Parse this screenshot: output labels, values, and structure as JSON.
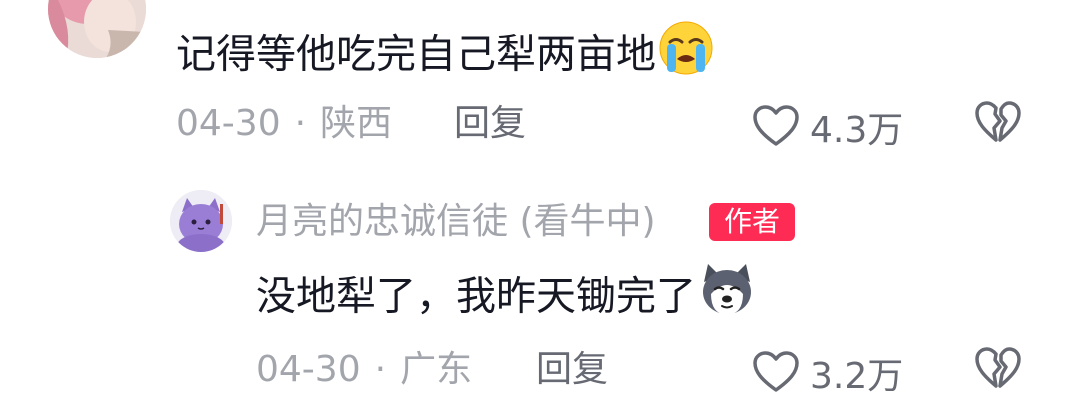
{
  "top_comment": {
    "text": "记得等他吃完自己犁两亩地",
    "emoji": "loudly-crying-face",
    "date": "04-30",
    "separator": "·",
    "location": "陕西",
    "reply_label": "回复",
    "likes": "4.3万"
  },
  "reply_comment": {
    "username": "月亮的忠诚信徒 (看牛中)",
    "badge": "作者",
    "text": "没地犁了，我昨天锄完了",
    "emoji": "husky-dog-face",
    "date": "04-30",
    "separator": "·",
    "location": "广东",
    "reply_label": "回复",
    "likes": "3.2万"
  },
  "colors": {
    "primary_text": "#161823",
    "secondary_text": "#a3a5ac",
    "action_text": "#676a73",
    "badge_bg": "#fe2c55"
  }
}
